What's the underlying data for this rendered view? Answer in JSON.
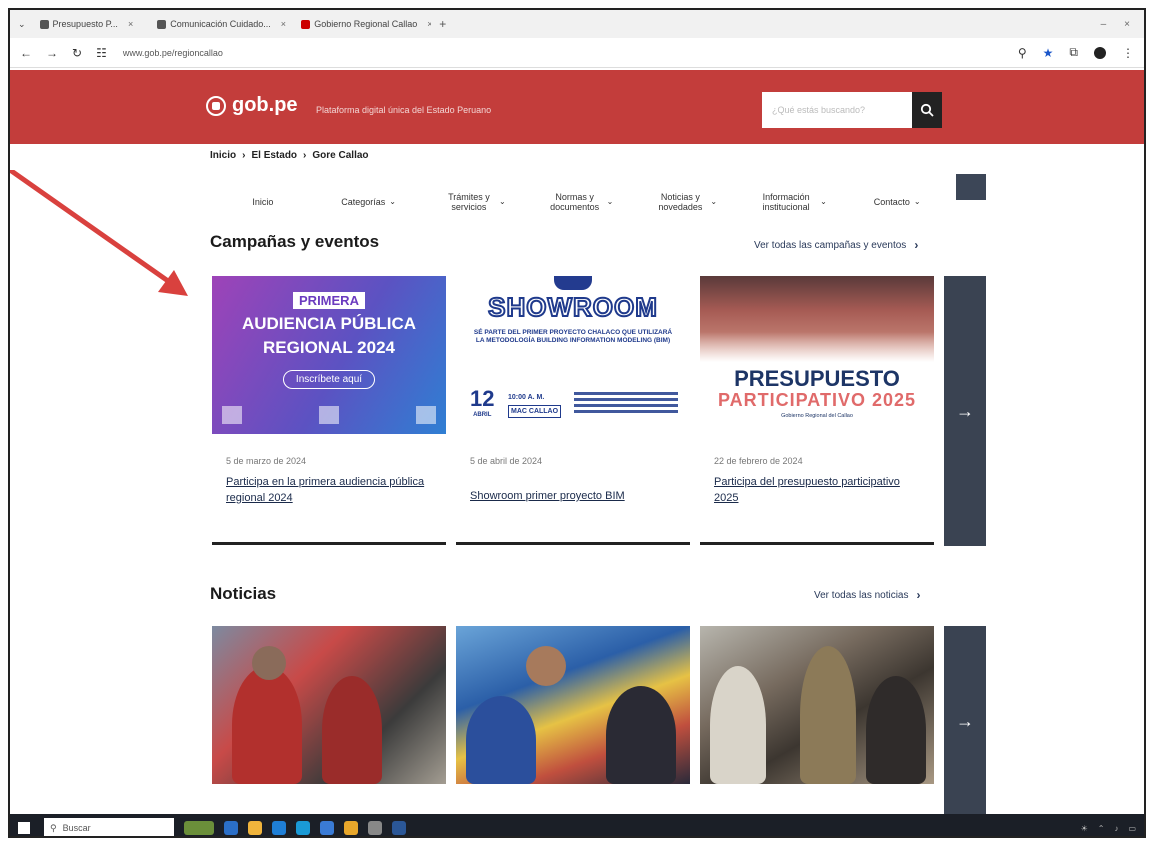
{
  "browser": {
    "tabs": [
      {
        "label": "Presupuesto P...",
        "favicon": "doc"
      },
      {
        "label": "Comunicación Cuidado...",
        "favicon": "doc"
      },
      {
        "label": "Gobierno Regional Callao",
        "favicon": "gob"
      }
    ],
    "url": "www.gob.pe/regioncallao"
  },
  "header": {
    "logo": "gob.pe",
    "tagline": "Plataforma digital única del Estado Peruano",
    "search_placeholder": "¿Qué estás buscando?"
  },
  "breadcrumb": [
    "Inicio",
    "El Estado",
    "Gore Callao"
  ],
  "nav": {
    "items": [
      {
        "label": "Inicio",
        "has_menu": false
      },
      {
        "label": "Categorías",
        "has_menu": true
      },
      {
        "label": "Trámites y servicios",
        "has_menu": true
      },
      {
        "label": "Normas y documentos",
        "has_menu": true
      },
      {
        "label": "Noticias y novedades",
        "has_menu": true
      },
      {
        "label": "Información institucional",
        "has_menu": true
      },
      {
        "label": "Contacto",
        "has_menu": true
      }
    ]
  },
  "campaigns": {
    "title": "Campañas y eventos",
    "see_all": "Ver todas las campañas y eventos",
    "cards": [
      {
        "date": "5 de marzo de 2024",
        "title": "Participa en la primera audiencia pública regional 2024",
        "image": {
          "tag": "PRIMERA",
          "line1": "AUDIENCIA PÚBLICA",
          "line2": "REGIONAL 2024",
          "button": "Inscríbete aquí"
        }
      },
      {
        "date": "5 de abril de 2024",
        "title": "Showroom primer proyecto BIM",
        "image": {
          "headline": "SHOWROOM",
          "sub": "SÉ PARTE DEL PRIMER PROYECTO CHALACO QUE UTILIZARÁ LA METODOLOGÍA BUILDING INFORMATION MODELING (BIM)",
          "day": "12",
          "month": "ABRIL",
          "time": "10:00 A. M.",
          "place": "MAC CALLAO"
        }
      },
      {
        "date": "22 de febrero de 2024",
        "title": "Participa del presupuesto participativo 2025",
        "image": {
          "line1": "PRESUPUESTO",
          "line2": "PARTICIPATIVO 2025",
          "line3": "Gobierno Regional del Callao"
        }
      }
    ]
  },
  "news": {
    "title": "Noticias",
    "see_all": "Ver todas las noticias"
  },
  "taskbar": {
    "search": "Buscar"
  }
}
